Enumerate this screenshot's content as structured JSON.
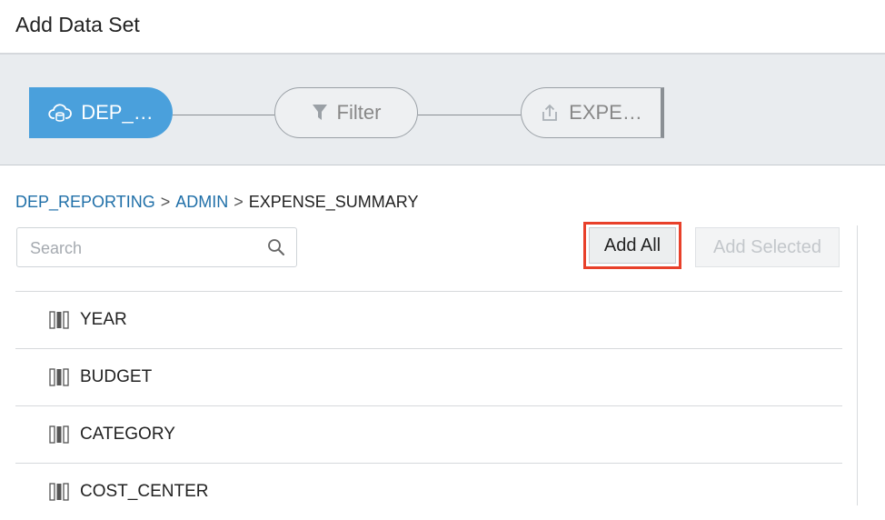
{
  "header": {
    "title": "Add Data Set"
  },
  "flow": {
    "source_label": "DEP_…",
    "filter_label": "Filter",
    "target_label": "EXPE…"
  },
  "breadcrumb": {
    "items": [
      "DEP_REPORTING",
      "ADMIN"
    ],
    "separator": ">",
    "current": "EXPENSE_SUMMARY"
  },
  "search": {
    "placeholder": "Search",
    "value": ""
  },
  "buttons": {
    "add_all": "Add All",
    "add_selected": "Add Selected"
  },
  "fields": [
    "YEAR",
    "BUDGET",
    "CATEGORY",
    "COST_CENTER"
  ],
  "icons": {
    "source": "cloud-database-icon",
    "filter": "funnel-icon",
    "target": "upload-icon",
    "search": "magnifier-icon",
    "column": "column-icon"
  },
  "colors": {
    "accent": "#4aa0dc",
    "link": "#1f6fa8",
    "highlight": "#e8402a"
  }
}
